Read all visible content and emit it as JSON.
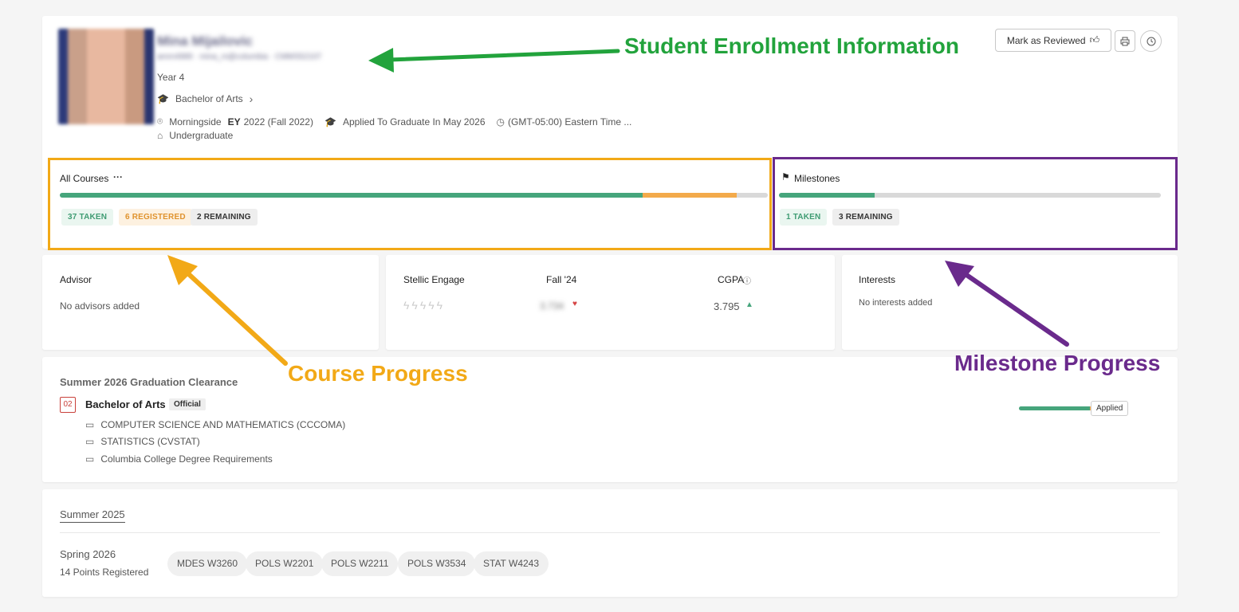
{
  "student": {
    "name": "Mina Mijailovic",
    "meta": "amm4989 · mina_m@columbia · CMMS52107",
    "year": "Year 4",
    "program": "Bachelor of Arts",
    "campus": "Morningside",
    "ey_label": "EY",
    "ey_value": "2022 (Fall 2022)",
    "graduation": "Applied To Graduate In May 2026",
    "timezone": "(GMT-05:00) Eastern Time ...",
    "level": "Undergraduate"
  },
  "header_actions": {
    "mark_reviewed": "Mark as Reviewed"
  },
  "courses": {
    "title": "All Courses",
    "more": "···",
    "taken": "37 TAKEN",
    "registered": "6 REGISTERED",
    "remaining": "2 REMAINING",
    "progress": {
      "taken": 0.8227,
      "registered": 0.1333
    }
  },
  "milestones": {
    "title": "Milestones",
    "taken": "1 TAKEN",
    "remaining": "3 REMAINING",
    "progress": {
      "taken": 0.25
    }
  },
  "advisor": {
    "title": "Advisor",
    "empty": "No advisors added"
  },
  "engage": {
    "title": "Stellic Engage",
    "term_label": "Fall '24",
    "term_value": "3.734",
    "cgpa_label": "CGPA",
    "cgpa_value": "3.795"
  },
  "interests": {
    "title": "Interests",
    "empty": "No interests added"
  },
  "clearance": {
    "title": "Summer 2026 Graduation Clearance",
    "badge": "02",
    "degree": "Bachelor of Arts",
    "official": "Official",
    "items": [
      "COMPUTER SCIENCE AND MATHEMATICS (CCCOMA)",
      "STATISTICS (CVSTAT)",
      "Columbia College Degree Requirements"
    ],
    "status": "Applied",
    "progress": {
      "done": 0.82,
      "pending": 0.12
    }
  },
  "terms": {
    "tab": "Summer 2025",
    "term": "Spring 2026",
    "points": "14 Points Registered",
    "courses": [
      "MDES W3260",
      "POLS W2201",
      "POLS W2211",
      "POLS W3534",
      "STAT W4243"
    ]
  },
  "annotations": {
    "enrollment": "Student Enrollment Information",
    "course_progress": "Course Progress",
    "milestone_progress": "Milestone Progress"
  },
  "colors": {
    "green": "#46a57c",
    "orange": "#f3aa4b",
    "annot_green": "#22a33c",
    "annot_orange": "#f2a917",
    "annot_purple": "#6a2a8c"
  }
}
